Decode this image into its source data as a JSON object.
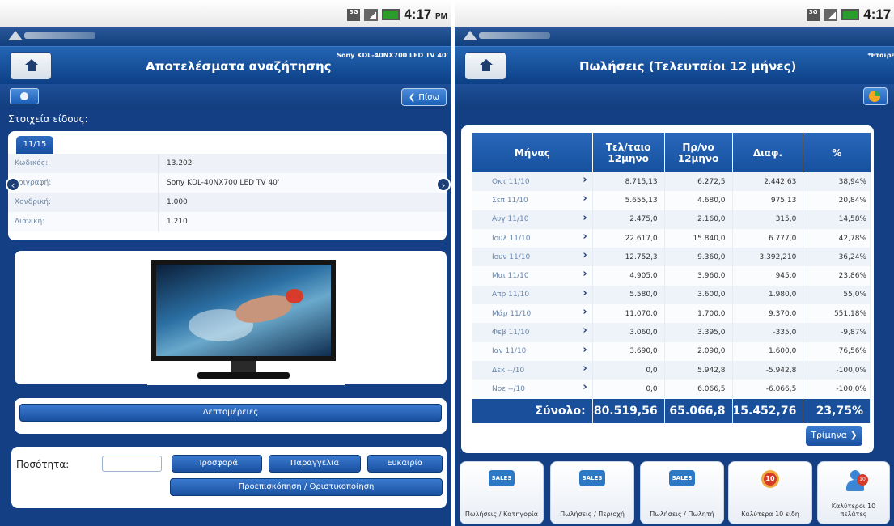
{
  "status": {
    "time": "4:17",
    "ampm": "PM",
    "network": "3G"
  },
  "left": {
    "header": {
      "title": "Αποτελέσματα αναζήτησης",
      "subtitle": "Sony KDL-40NX700 LED TV 40'"
    },
    "toolbar": {
      "back_label": "Πίσω"
    },
    "section_label": "Στοιχεία είδους:",
    "pager": "11/15",
    "details": [
      {
        "label": "Κωδικός:",
        "value": "13.202"
      },
      {
        "label": "εριγραφή:",
        "value": "Sony KDL-40NX700 LED TV 40'"
      },
      {
        "label": "Χονδρική:",
        "value": "1.000"
      },
      {
        "label": "Λιανική:",
        "value": "1.210"
      }
    ],
    "details_button": "Λεπτομέρειες",
    "quantity": {
      "label": "Ποσότητα:",
      "value": ""
    },
    "buttons": {
      "offer": "Προσφορά",
      "order": "Παραγγελία",
      "opportunity": "Ευκαιρία",
      "preview": "Προεπισκόπηση / Οριστικοποίηση"
    }
  },
  "right": {
    "header": {
      "title": "Πωλήσεις (Τελευταίοι 12 μήνες)",
      "subtitle": "*Εταιρεί"
    },
    "table": {
      "headers": [
        "Μήνας",
        "Τελ/ταιο 12μηνο",
        "Πρ/νο 12μηνο",
        "Διαφ.",
        "%"
      ],
      "rows": [
        [
          "Οκτ 11/10",
          "8.715,13",
          "6.272,5",
          "2.442,63",
          "38,94%"
        ],
        [
          "Σεπ 11/10",
          "5.655,13",
          "4.680,0",
          "975,13",
          "20,84%"
        ],
        [
          "Αυγ 11/10",
          "2.475,0",
          "2.160,0",
          "315,0",
          "14,58%"
        ],
        [
          "Ιουλ 11/10",
          "22.617,0",
          "15.840,0",
          "6.777,0",
          "42,78%"
        ],
        [
          "Ιουν 11/10",
          "12.752,3",
          "9.360,0",
          "3.392,210",
          "36,24%"
        ],
        [
          "Μαι 11/10",
          "4.905,0",
          "3.960,0",
          "945,0",
          "23,86%"
        ],
        [
          "Απρ 11/10",
          "5.580,0",
          "3.600,0",
          "1.980,0",
          "55,0%"
        ],
        [
          "Μάρ 11/10",
          "11.070,0",
          "1.700,0",
          "9.370,0",
          "551,18%"
        ],
        [
          "Φεβ 11/10",
          "3.060,0",
          "3.395,0",
          "-335,0",
          "-9,87%"
        ],
        [
          "Ιαν 11/10",
          "3.690,0",
          "2.090,0",
          "1.600,0",
          "76,56%"
        ],
        [
          "Δεκ --/10",
          "0,0",
          "5.942,8",
          "-5.942,8",
          "-100,0%"
        ],
        [
          "Νοε --/10",
          "0,0",
          "6.066,5",
          "-6.066,5",
          "-100,0%"
        ]
      ],
      "total": [
        "Σύνολο:",
        "80.519,56",
        "65.066,8",
        "15.452,76",
        "23,75%"
      ]
    },
    "trimina_button": "Τρίμηνα",
    "dock": [
      {
        "label": "Πωλήσεις / Κατηγορία",
        "icon": "sales-category-icon",
        "badge": "SALES"
      },
      {
        "label": "Πωλήσεις / Περιοχή",
        "icon": "sales-region-icon",
        "badge": "SALES"
      },
      {
        "label": "Πωλήσεις / Πωλητή",
        "icon": "sales-salesman-icon",
        "badge": "SALES"
      },
      {
        "label": "Καλύτερα 10 είδη",
        "icon": "top10-items-icon",
        "badge": "10"
      },
      {
        "label": "Καλύτεροι 10 πελάτες",
        "icon": "top10-customers-icon",
        "badge": "10"
      }
    ]
  }
}
